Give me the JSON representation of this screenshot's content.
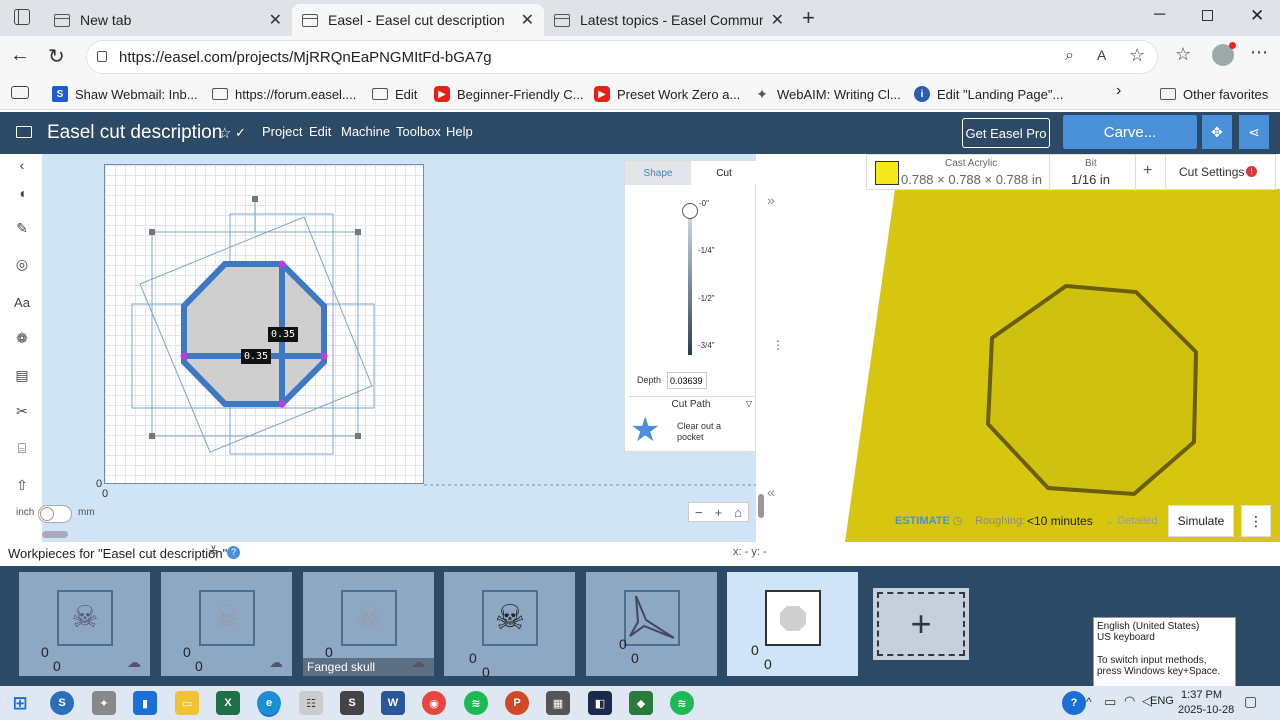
{
  "browser": {
    "tabs": [
      {
        "label": "New tab"
      },
      {
        "label": "Easel - Easel cut description"
      },
      {
        "label": "Latest topics - Easel Community F"
      }
    ],
    "url": "https://easel.com/projects/MjRRQnEaPNGMItFd-bGA7g",
    "favorites": [
      {
        "label": "Shaw Webmail: Inb...",
        "icon": "S",
        "color": "#1a5bd6"
      },
      {
        "label": "https://forum.easel....",
        "icon": "",
        "color": "#777"
      },
      {
        "label": "Edit",
        "icon": "",
        "color": "#777"
      },
      {
        "label": "Beginner-Friendly C...",
        "icon": "▶",
        "color": "#e62117"
      },
      {
        "label": "Preset Work Zero a...",
        "icon": "▶",
        "color": "#e62117"
      },
      {
        "label": "WebAIM: Writing Cl...",
        "icon": "✦",
        "color": "#555"
      },
      {
        "label": "Edit \"Landing Page\"...",
        "icon": "i",
        "color": "#2a5db0"
      }
    ],
    "other_favorites": "Other favorites"
  },
  "app": {
    "title": "Easel cut description",
    "menu": [
      "Project",
      "Edit",
      "Machine",
      "Toolbox",
      "Help"
    ],
    "get_pro": "Get Easel Pro",
    "carve": "Carve..."
  },
  "canvas": {
    "dim_h": "0.35",
    "dim_v": "0.35",
    "axis_y0": "0",
    "axis_x0": "0",
    "unit_inch": "inch",
    "unit_mm": "mm"
  },
  "cut_panel": {
    "tabs": [
      "Shape",
      "Cut"
    ],
    "depth_ticks": [
      "-0\"",
      "-1/4\"",
      "-1/2\"",
      "-3/4\""
    ],
    "depth_label": "Depth",
    "depth_value": "0.03639",
    "cut_path": "Cut Path",
    "cut_type": "Clear out a pocket"
  },
  "material": {
    "name": "Cast Acrylic",
    "dims": "0.788 × 0.788 × 0.788 in",
    "bit_label": "Bit",
    "bit_value": "1/16 in",
    "cut_settings": "Cut Settings",
    "color": "#f5e81c"
  },
  "estimate": {
    "label": "ESTIMATE",
    "roughing_label": "Roughing:",
    "roughing_value": "<10 minutes",
    "detailed": "Detailed",
    "simulate": "Simulate"
  },
  "workpieces": {
    "title": "Workpieces for \"Easel cut description\"",
    "coords": "x: - y: -",
    "items": [
      {
        "a": "0",
        "b": "0",
        "label": ""
      },
      {
        "a": "0",
        "b": "0",
        "label": ""
      },
      {
        "a": "0",
        "b": "0",
        "label": "Fanged skull"
      },
      {
        "a": "0",
        "b": "0",
        "label": ""
      },
      {
        "a": "0",
        "b": "0",
        "label": ""
      },
      {
        "a": "0",
        "b": "0",
        "label": ""
      }
    ]
  },
  "ime": {
    "line1": "English (United States)",
    "line2": "US keyboard",
    "line3": "To switch input methods, press Windows key+Space."
  },
  "taskbar": {
    "lang": "ENG",
    "time": "1:37 PM",
    "date": "2025-10-28"
  }
}
